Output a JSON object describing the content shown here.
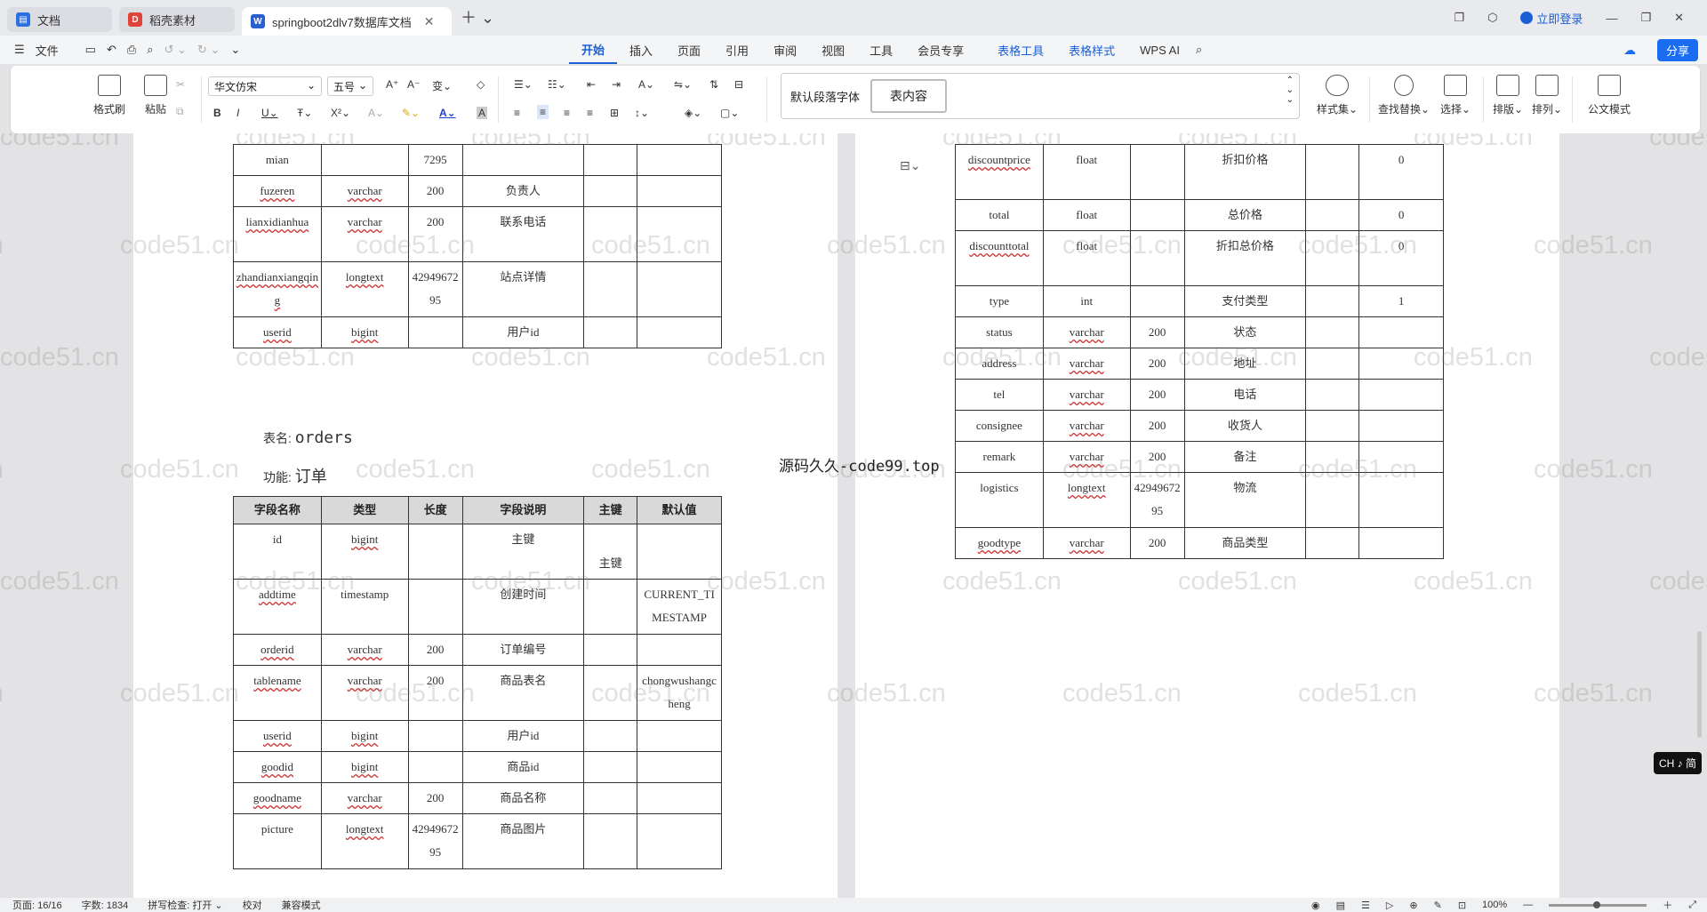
{
  "tabs": [
    {
      "label": "文档",
      "icon": "docs-icon",
      "color": "#2b6fe0"
    },
    {
      "label": "稻壳素材",
      "icon": "docer-icon",
      "color": "#e0433a"
    },
    {
      "label": "springboot2dlv7数据库文档",
      "icon": "word-icon",
      "color": "#2b5fd0"
    }
  ],
  "titlebar": {
    "login": "立即登录"
  },
  "menu": {
    "file": "文件",
    "tabs": [
      "开始",
      "插入",
      "页面",
      "引用",
      "审阅",
      "视图",
      "工具",
      "会员专享",
      "表格工具",
      "表格样式",
      "WPS AI"
    ],
    "share": "分享"
  },
  "ribbon": {
    "format_painter": "格式刷",
    "paste": "粘贴",
    "font_name": "华文仿宋",
    "font_size": "五号",
    "style_default": "默认段落字体",
    "style_selected": "表内容",
    "style_set": "样式集",
    "find_replace": "查找替换",
    "select": "选择",
    "layout": "排版",
    "arrange": "排列",
    "doc_mode": "公文模式"
  },
  "left_page": {
    "top_table_rows": [
      {
        "name": "mian",
        "type": "",
        "len": "7295",
        "desc": "",
        "pk": "",
        "def": "",
        "u_name": false,
        "u_type": false
      },
      {
        "name": "fuzeren",
        "type": "varchar",
        "len": "200",
        "desc": "负责人",
        "pk": "",
        "def": "",
        "u_name": true,
        "u_type": true
      },
      {
        "name": "lianxidianhua",
        "type": "varchar",
        "len": "200",
        "desc": "联系电话",
        "pk": "",
        "def": "",
        "u_name": true,
        "u_type": true
      },
      {
        "name": "zhandianxiangqing",
        "type": "longtext",
        "len": "4294967295",
        "desc": "站点详情",
        "pk": "",
        "def": "",
        "u_name": true,
        "u_type": true
      },
      {
        "name": "userid",
        "type": "bigint",
        "len": "",
        "desc": "用户id",
        "pk": "",
        "def": "",
        "u_name": true,
        "u_type": true
      }
    ],
    "table_label": "表名:",
    "table_name": "orders",
    "func_label": "功能:",
    "func_value": "订单",
    "headers": [
      "字段名称",
      "类型",
      "长度",
      "字段说明",
      "主键",
      "默认值"
    ],
    "orders_rows": [
      {
        "name": "id",
        "type": "bigint",
        "len": "",
        "desc": "主键",
        "pk": "主键",
        "def": "",
        "u_name": false,
        "u_type": true
      },
      {
        "name": "addtime",
        "type": "timestamp",
        "len": "",
        "desc": "创建时间",
        "pk": "",
        "def": "CURRENT_TIMESTAMP",
        "u_name": true,
        "u_type": false
      },
      {
        "name": "orderid",
        "type": "varchar",
        "len": "200",
        "desc": "订单编号",
        "pk": "",
        "def": "",
        "u_name": true,
        "u_type": true
      },
      {
        "name": "tablename",
        "type": "varchar",
        "len": "200",
        "desc": "商品表名",
        "pk": "",
        "def": "chongwushangcheng",
        "u_name": true,
        "u_type": true
      },
      {
        "name": "userid",
        "type": "bigint",
        "len": "",
        "desc": "用户id",
        "pk": "",
        "def": "",
        "u_name": true,
        "u_type": true
      },
      {
        "name": "goodid",
        "type": "bigint",
        "len": "",
        "desc": "商品id",
        "pk": "",
        "def": "",
        "u_name": true,
        "u_type": true
      },
      {
        "name": "goodname",
        "type": "varchar",
        "len": "200",
        "desc": "商品名称",
        "pk": "",
        "def": "",
        "u_name": true,
        "u_type": true
      },
      {
        "name": "picture",
        "type": "longtext",
        "len": "4294967295",
        "desc": "商品图片",
        "pk": "",
        "def": "",
        "u_name": false,
        "u_type": true
      }
    ]
  },
  "right_page": {
    "rows": [
      {
        "name": "discountprice",
        "type": "float",
        "len": "",
        "desc": "折扣价格",
        "pk": "",
        "def": "0",
        "u_name": true,
        "u_type": false
      },
      {
        "name": "total",
        "type": "float",
        "len": "",
        "desc": "总价格",
        "pk": "",
        "def": "0",
        "u_name": false,
        "u_type": false
      },
      {
        "name": "discounttotal",
        "type": "float",
        "len": "",
        "desc": "折扣总价格",
        "pk": "",
        "def": "0",
        "u_name": true,
        "u_type": false
      },
      {
        "name": "type",
        "type": "int",
        "len": "",
        "desc": "支付类型",
        "pk": "",
        "def": "1",
        "u_name": false,
        "u_type": false
      },
      {
        "name": "status",
        "type": "varchar",
        "len": "200",
        "desc": "状态",
        "pk": "",
        "def": "",
        "u_name": false,
        "u_type": true
      },
      {
        "name": "address",
        "type": "varchar",
        "len": "200",
        "desc": "地址",
        "pk": "",
        "def": "",
        "u_name": false,
        "u_type": true
      },
      {
        "name": "tel",
        "type": "varchar",
        "len": "200",
        "desc": "电话",
        "pk": "",
        "def": "",
        "u_name": false,
        "u_type": true
      },
      {
        "name": "consignee",
        "type": "varchar",
        "len": "200",
        "desc": "收货人",
        "pk": "",
        "def": "",
        "u_name": false,
        "u_type": true
      },
      {
        "name": "remark",
        "type": "varchar",
        "len": "200",
        "desc": "备注",
        "pk": "",
        "def": "",
        "u_name": false,
        "u_type": true
      },
      {
        "name": "logistics",
        "type": "longtext",
        "len": "4294967295",
        "desc": "物流",
        "pk": "",
        "def": "",
        "u_name": false,
        "u_type": true
      },
      {
        "name": "goodtype",
        "type": "varchar",
        "len": "200",
        "desc": "商品类型",
        "pk": "",
        "def": "",
        "u_name": true,
        "u_type": true
      }
    ]
  },
  "overlay_text": "源码久久-code99.top",
  "watermark": "code51.cn",
  "status": {
    "page": "页面: 16/16",
    "words": "字数: 1834",
    "spell": "拼写检查: 打开",
    "proof": "校对",
    "compat": "兼容模式",
    "zoom": "100%"
  },
  "ime": "CH ♪ 简",
  "colors": {
    "accent": "#1a5fd6",
    "header_bg": "#d9d9d9",
    "spell_underline": "#cc3333"
  }
}
